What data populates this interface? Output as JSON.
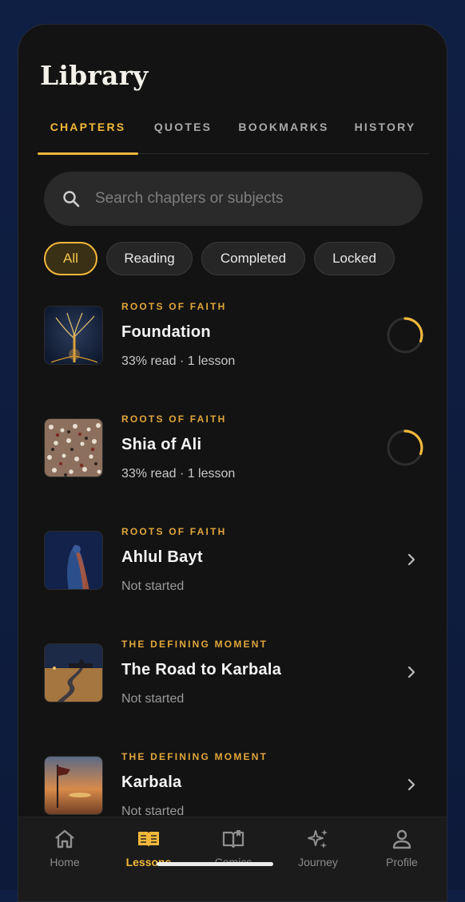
{
  "header": {
    "title": "Library"
  },
  "tabs": [
    {
      "label": "CHAPTERS",
      "active": true
    },
    {
      "label": "QUOTES",
      "active": false
    },
    {
      "label": "BOOKMARKS",
      "active": false
    },
    {
      "label": "HISTORY",
      "active": false
    }
  ],
  "search": {
    "placeholder": "Search chapters or subjects",
    "icon": "search-icon"
  },
  "filters": [
    {
      "label": "All",
      "active": true
    },
    {
      "label": "Reading",
      "active": false
    },
    {
      "label": "Completed",
      "active": false
    },
    {
      "label": "Locked",
      "active": false
    }
  ],
  "chapters": [
    {
      "category": "ROOTS OF FAITH",
      "title": "Foundation",
      "status": "33% read · 1 lesson",
      "progress": 0.33,
      "indicator": "progress-ring"
    },
    {
      "category": "ROOTS OF FAITH",
      "title": "Shia of Ali",
      "status": "33% read · 1 lesson",
      "progress": 0.33,
      "indicator": "progress-ring"
    },
    {
      "category": "ROOTS OF FAITH",
      "title": "Ahlul Bayt",
      "status": "Not started",
      "indicator": "chevron-right-icon"
    },
    {
      "category": "THE DEFINING MOMENT",
      "title": "The Road to Karbala",
      "status": "Not started",
      "indicator": "chevron-right-icon"
    },
    {
      "category": "THE DEFINING MOMENT",
      "title": "Karbala",
      "status": "Not started",
      "indicator": "chevron-right-icon"
    }
  ],
  "bottom_nav": [
    {
      "label": "Home",
      "icon": "home-icon",
      "active": false
    },
    {
      "label": "Lessons",
      "icon": "book-open-icon",
      "active": true
    },
    {
      "label": "Comics",
      "icon": "comic-book-icon",
      "active": false
    },
    {
      "label": "Journey",
      "icon": "sparkles-icon",
      "active": false
    },
    {
      "label": "Profile",
      "icon": "person-icon",
      "active": false
    }
  ],
  "colors": {
    "accent": "#f3b83b",
    "background": "#131313",
    "outer": "#0f1f44",
    "surface": "#2a2a2a"
  }
}
